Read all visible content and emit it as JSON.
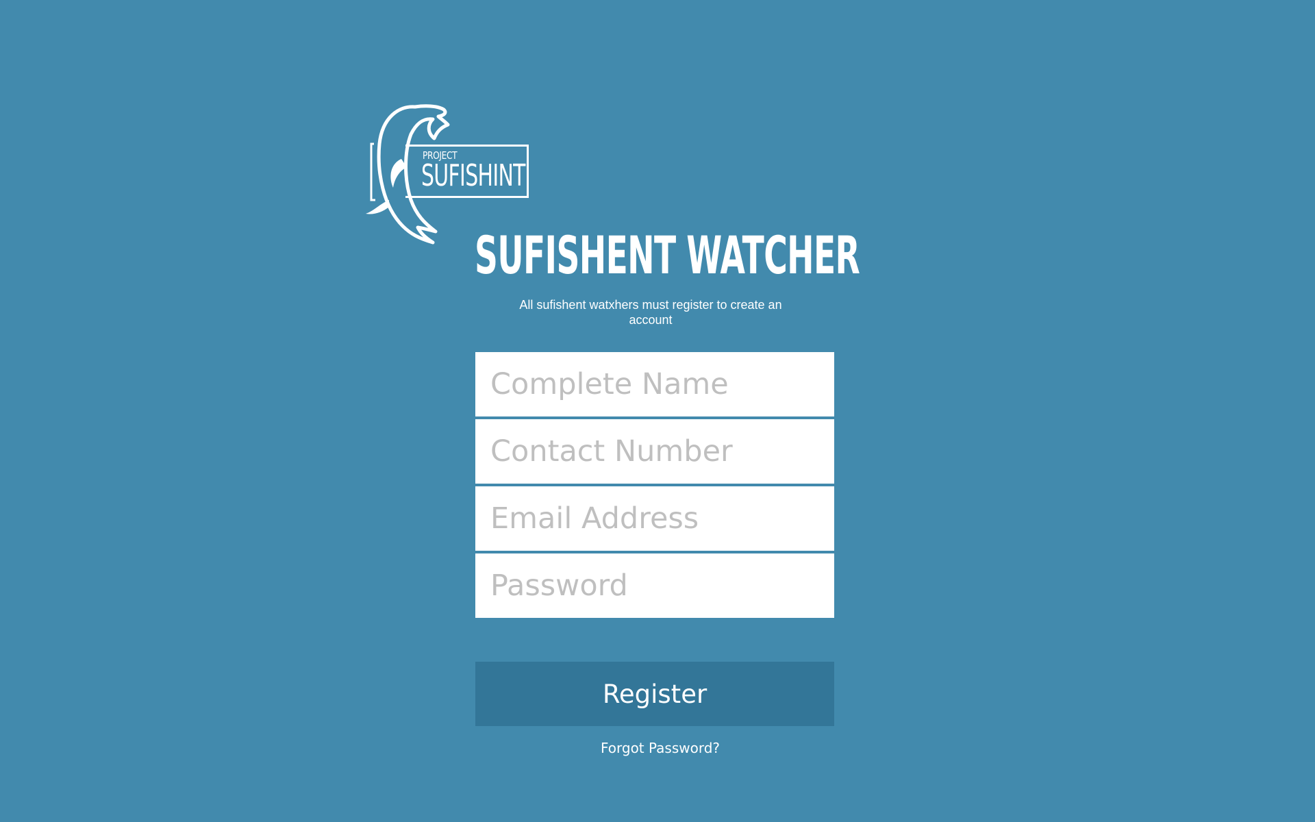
{
  "logo": {
    "line1": "PROJECT",
    "line2": "SUFISHINT"
  },
  "header": {
    "title": "SUFISHENT WATCHER",
    "subtitle": "All sufishent watxhers must register to create an account"
  },
  "form": {
    "name_placeholder": "Complete Name",
    "contact_placeholder": "Contact Number",
    "email_placeholder": "Email Address",
    "password_placeholder": "Password",
    "register_label": "Register",
    "forgot_label": "Forgot Password?"
  },
  "colors": {
    "background": "#428aad",
    "button": "#337698",
    "field": "#ffffff",
    "placeholder": "#bfbfbf"
  }
}
